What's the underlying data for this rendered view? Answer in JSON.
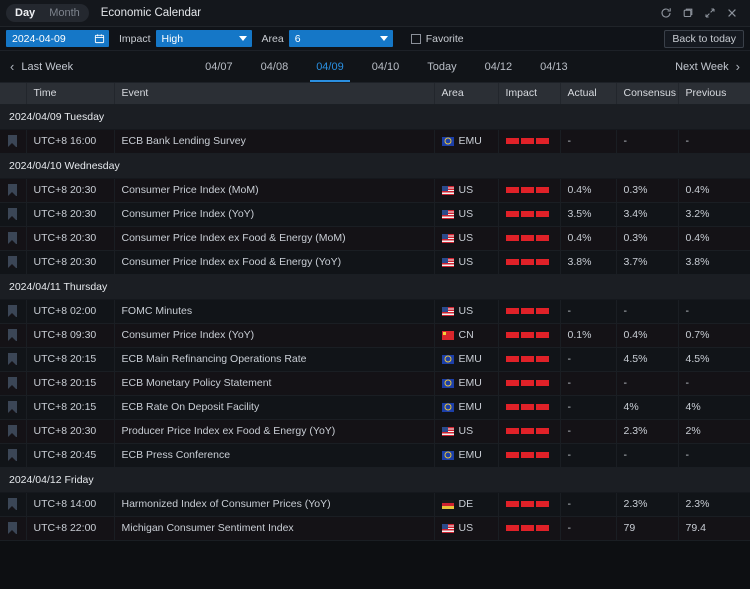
{
  "titlebar": {
    "modes": [
      {
        "label": "Day",
        "active": true
      },
      {
        "label": "Month",
        "active": false
      }
    ],
    "app_title": "Economic Calendar",
    "window_buttons": [
      {
        "name": "refresh-icon",
        "label": "refresh-icon"
      },
      {
        "name": "restore-icon",
        "label": "restore-icon"
      },
      {
        "name": "expand-icon",
        "label": "expand-icon"
      },
      {
        "name": "close-icon",
        "label": "close-icon"
      }
    ]
  },
  "filterbar": {
    "date_value": "2024-04-09",
    "calendar_icon": "calendar-icon",
    "impact_label": "Impact",
    "impact_value": "High",
    "area_label": "Area",
    "area_value": "6",
    "favorite_label": "Favorite",
    "favorite_checked": false,
    "back_to_today": "Back to today",
    "accent_blue": "#1577c7"
  },
  "weeknav": {
    "prev_label": "Last Week",
    "next_label": "Next Week",
    "selected": "04/09",
    "days": [
      {
        "label": "04/07",
        "selected": false
      },
      {
        "label": "04/08",
        "selected": false
      },
      {
        "label": "04/09",
        "selected": true
      },
      {
        "label": "04/10",
        "selected": false
      },
      {
        "label": "Today",
        "selected": false
      },
      {
        "label": "04/12",
        "selected": false
      },
      {
        "label": "04/13",
        "selected": false
      }
    ],
    "highlight_color": "#2a8fe0"
  },
  "table": {
    "columns": [
      "",
      "Time",
      "Event",
      "Area",
      "Impact",
      "Actual",
      "Consensus",
      "Previous"
    ],
    "impact_color": "#e02128",
    "groups": [
      {
        "title": "2024/04/09 Tuesday",
        "rows": [
          {
            "time": "UTC+8 16:00",
            "event": "ECB Bank Lending Survey",
            "area": "EMU",
            "flag": "emu",
            "impact": 3,
            "actual": "-",
            "consensus": "-",
            "previous": "-"
          }
        ]
      },
      {
        "title": "2024/04/10 Wednesday",
        "rows": [
          {
            "time": "UTC+8 20:30",
            "event": "Consumer Price Index (MoM)",
            "area": "US",
            "flag": "us",
            "impact": 3,
            "actual": "0.4%",
            "consensus": "0.3%",
            "previous": "0.4%"
          },
          {
            "time": "UTC+8 20:30",
            "event": "Consumer Price Index (YoY)",
            "area": "US",
            "flag": "us",
            "impact": 3,
            "actual": "3.5%",
            "consensus": "3.4%",
            "previous": "3.2%"
          },
          {
            "time": "UTC+8 20:30",
            "event": "Consumer Price Index ex Food & Energy (MoM)",
            "area": "US",
            "flag": "us",
            "impact": 3,
            "actual": "0.4%",
            "consensus": "0.3%",
            "previous": "0.4%"
          },
          {
            "time": "UTC+8 20:30",
            "event": "Consumer Price Index ex Food & Energy (YoY)",
            "area": "US",
            "flag": "us",
            "impact": 3,
            "actual": "3.8%",
            "consensus": "3.7%",
            "previous": "3.8%"
          }
        ]
      },
      {
        "title": "2024/04/11 Thursday",
        "rows": [
          {
            "time": "UTC+8 02:00",
            "event": "FOMC Minutes",
            "area": "US",
            "flag": "us",
            "impact": 3,
            "actual": "-",
            "consensus": "-",
            "previous": "-"
          },
          {
            "time": "UTC+8 09:30",
            "event": "Consumer Price Index (YoY)",
            "area": "CN",
            "flag": "cn",
            "impact": 3,
            "actual": "0.1%",
            "consensus": "0.4%",
            "previous": "0.7%"
          },
          {
            "time": "UTC+8 20:15",
            "event": "ECB Main Refinancing Operations Rate",
            "area": "EMU",
            "flag": "emu",
            "impact": 3,
            "actual": "-",
            "consensus": "4.5%",
            "previous": "4.5%"
          },
          {
            "time": "UTC+8 20:15",
            "event": "ECB Monetary Policy Statement",
            "area": "EMU",
            "flag": "emu",
            "impact": 3,
            "actual": "-",
            "consensus": "-",
            "previous": "-"
          },
          {
            "time": "UTC+8 20:15",
            "event": "ECB Rate On Deposit Facility",
            "area": "EMU",
            "flag": "emu",
            "impact": 3,
            "actual": "-",
            "consensus": "4%",
            "previous": "4%"
          },
          {
            "time": "UTC+8 20:30",
            "event": "Producer Price Index ex Food & Energy (YoY)",
            "area": "US",
            "flag": "us",
            "impact": 3,
            "actual": "-",
            "consensus": "2.3%",
            "previous": "2%"
          },
          {
            "time": "UTC+8 20:45",
            "event": "ECB Press Conference",
            "area": "EMU",
            "flag": "emu",
            "impact": 3,
            "actual": "-",
            "consensus": "-",
            "previous": "-"
          }
        ]
      },
      {
        "title": "2024/04/12 Friday",
        "rows": [
          {
            "time": "UTC+8 14:00",
            "event": "Harmonized Index of Consumer Prices (YoY)",
            "area": "DE",
            "flag": "de",
            "impact": 3,
            "actual": "-",
            "consensus": "2.3%",
            "previous": "2.3%"
          },
          {
            "time": "UTC+8 22:00",
            "event": "Michigan Consumer Sentiment Index",
            "area": "US",
            "flag": "us",
            "impact": 3,
            "actual": "-",
            "consensus": "79",
            "previous": "79.4"
          }
        ]
      }
    ]
  }
}
